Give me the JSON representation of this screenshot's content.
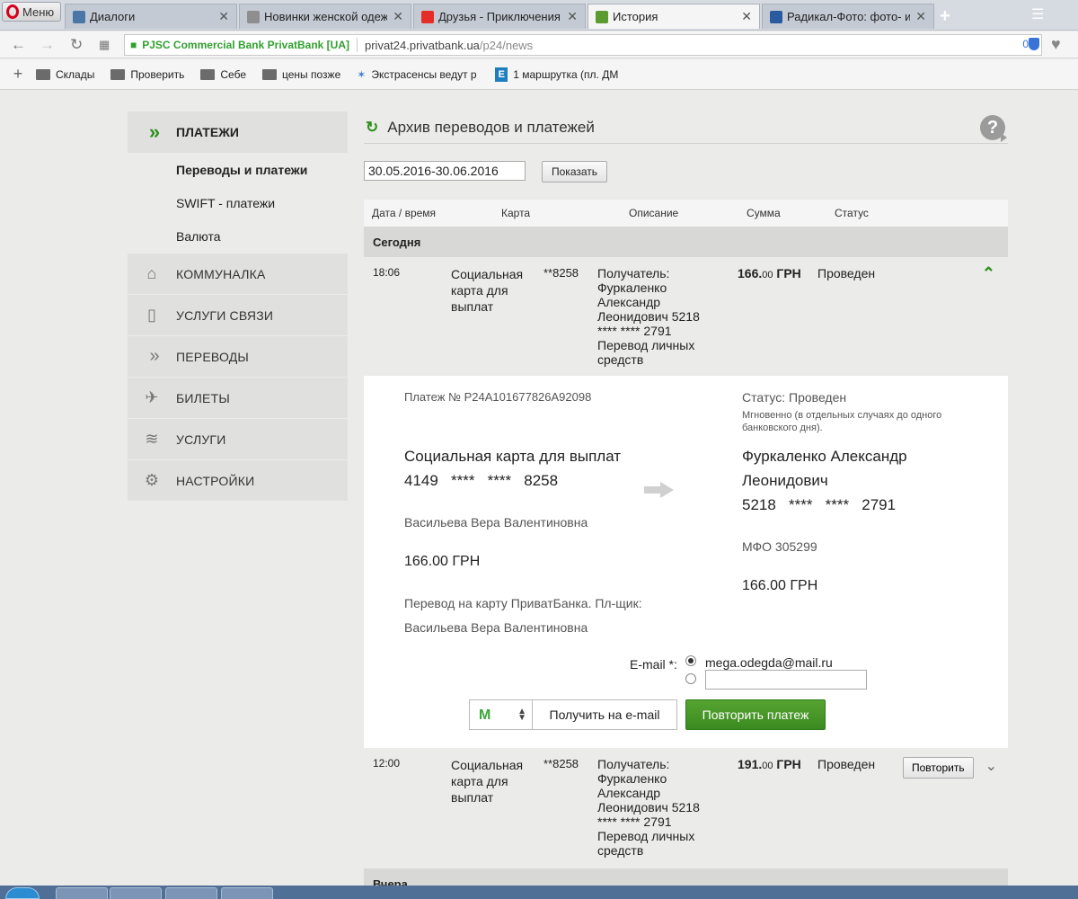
{
  "browser": {
    "menu_label": "Меню",
    "tabs": [
      {
        "title": "Диалоги",
        "favicon_color": "#4a76a8"
      },
      {
        "title": "Новинки женской одежд",
        "favicon_color": "#8e8e8e"
      },
      {
        "title": "Друзья - Приключения м",
        "favicon_color": "#e52d27"
      },
      {
        "title": "История",
        "favicon_color": "#5b9b2f"
      },
      {
        "title": "Радикал-Фото: фото- и ви",
        "favicon_color": "#2a5b9e"
      }
    ],
    "new_tab": "+",
    "cert_name": "PJSC Commercial Bank PrivatBank [UA]",
    "url_host": "privat24.privatbank.ua",
    "url_path": "/p24/news",
    "badge_count": "0",
    "bookmarks": [
      {
        "label": "Склады",
        "icon": "folder-icon"
      },
      {
        "label": "Проверить",
        "icon": "folder-icon"
      },
      {
        "label": "Себе",
        "icon": "folder-icon"
      },
      {
        "label": "цены позже",
        "icon": "folder-icon"
      },
      {
        "label": "Экстрасенсы ведут р",
        "icon": "star-icon"
      },
      {
        "label": "1 маршрутка (пл. ДМ",
        "icon": "e-icon"
      }
    ]
  },
  "sidebar": {
    "header": "ПЛАТЕЖИ",
    "subitems": [
      "Переводы и платежи",
      "SWIFT - платежи",
      "Валюта"
    ],
    "items": [
      {
        "label": "КОММУНАЛКА",
        "icon": "house-icon"
      },
      {
        "label": "УСЛУГИ СВЯЗИ",
        "icon": "phone-icon"
      },
      {
        "label": "ПЕРЕВОДЫ",
        "icon": "chevrons-icon"
      },
      {
        "label": "БИЛЕТЫ",
        "icon": "tickets-icon"
      },
      {
        "label": "УСЛУГИ",
        "icon": "layers-icon"
      },
      {
        "label": "НАСТРОЙКИ",
        "icon": "gear-icon"
      }
    ]
  },
  "main": {
    "title": "Архив переводов и платежей",
    "date_range": "30.05.2016-30.06.2016",
    "show_button": "Показать",
    "columns": [
      "Дата / время",
      "Карта",
      "Описание",
      "Сумма",
      "Статус"
    ],
    "group_today": "Сегодня",
    "group_yesterday": "Вчера",
    "transactions": [
      {
        "time": "18:06",
        "card_name": [
          "Социальная",
          "карта для",
          "выплат"
        ],
        "card_num": "**8258",
        "desc": [
          "Получатель:",
          "Фуркаленко",
          "Александр",
          "Леонидович 5218",
          "**** **** 2791",
          "Перевод личных",
          "средств"
        ],
        "sum_int": "166.",
        "sum_frac": "00",
        "currency": "ГРН",
        "status": "Проведен"
      },
      {
        "time": "12:00",
        "card_name": [
          "Социальная",
          "карта для",
          "выплат"
        ],
        "card_num": "**8258",
        "desc": [
          "Получатель:",
          "Фуркаленко",
          "Александр",
          "Леонидович 5218",
          "**** **** 2791",
          "Перевод личных",
          "средств"
        ],
        "sum_int": "191.",
        "sum_frac": "00",
        "currency": "ГРН",
        "status": "Проведен",
        "repeat_label": "Повторить"
      }
    ],
    "details": {
      "payment_no": "Платеж № P24A101677826A92098",
      "status": "Статус: Проведен",
      "status_note": [
        "Мгновенно (в отдельных случаях до одного",
        "банковского дня)."
      ],
      "from_card_name": "Социальная карта для выплат",
      "from_card_num": "4149   ****   ****   8258",
      "from_holder": "Васильева Вера Валентиновна",
      "from_amount": "166.00 ГРН",
      "purpose": "Перевод на карту ПриватБанка. Пл-щик:",
      "purpose_holder": "Васильева Вера Валентиновна",
      "to_name": [
        "Фуркаленко Александр",
        "Леонидович"
      ],
      "to_card_num": "5218   ****   ****   2791",
      "to_mfo": "МФО 305299",
      "to_amount": "166.00 ГРН",
      "email_label": "E-mail *:",
      "email_value": "mega.odegda@mail.ru",
      "get_email_button": "Получить на e-mail",
      "repeat_payment_button": "Повторить платеж"
    }
  }
}
